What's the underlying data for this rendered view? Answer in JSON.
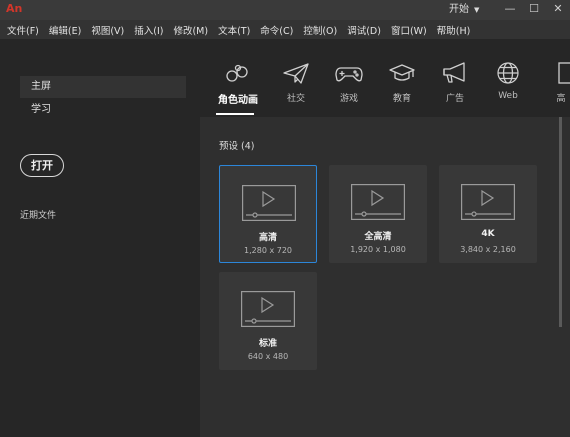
{
  "app": {
    "logo": "An",
    "workspace": "开始",
    "window_controls": [
      "—",
      "☐",
      "✕"
    ]
  },
  "menu": [
    "文件(F)",
    "编辑(E)",
    "视图(V)",
    "插入(I)",
    "修改(M)",
    "文本(T)",
    "命令(C)",
    "控制(O)",
    "调试(D)",
    "窗口(W)",
    "帮助(H)"
  ],
  "sidebar": {
    "items": [
      {
        "label": "主屏",
        "active": true
      },
      {
        "label": "学习",
        "active": false
      }
    ],
    "open_button": "打开",
    "recent_label": "近期文件"
  },
  "categories": [
    {
      "label": "角色动画",
      "icon": "character-animation-icon",
      "active": true
    },
    {
      "label": "社交",
      "icon": "paper-plane-icon",
      "active": false
    },
    {
      "label": "游戏",
      "icon": "gamepad-icon",
      "active": false
    },
    {
      "label": "教育",
      "icon": "graduation-cap-icon",
      "active": false
    },
    {
      "label": "广告",
      "icon": "megaphone-icon",
      "active": false
    },
    {
      "label": "Web",
      "icon": "globe-icon",
      "active": false
    },
    {
      "label": "高",
      "icon": "advanced-icon",
      "active": false
    }
  ],
  "presets": {
    "title": "预设 (4)",
    "items": [
      {
        "name": "高清",
        "dimensions": "1,280 x 720",
        "selected": true
      },
      {
        "name": "全高清",
        "dimensions": "1,920 x 1,080",
        "selected": false
      },
      {
        "name": "4K",
        "dimensions": "3,840 x 2,160",
        "selected": false
      },
      {
        "name": "标准",
        "dimensions": "640 x 480",
        "selected": false
      }
    ]
  },
  "colors": {
    "accent": "#2c86d9",
    "logo": "#d2362a"
  }
}
